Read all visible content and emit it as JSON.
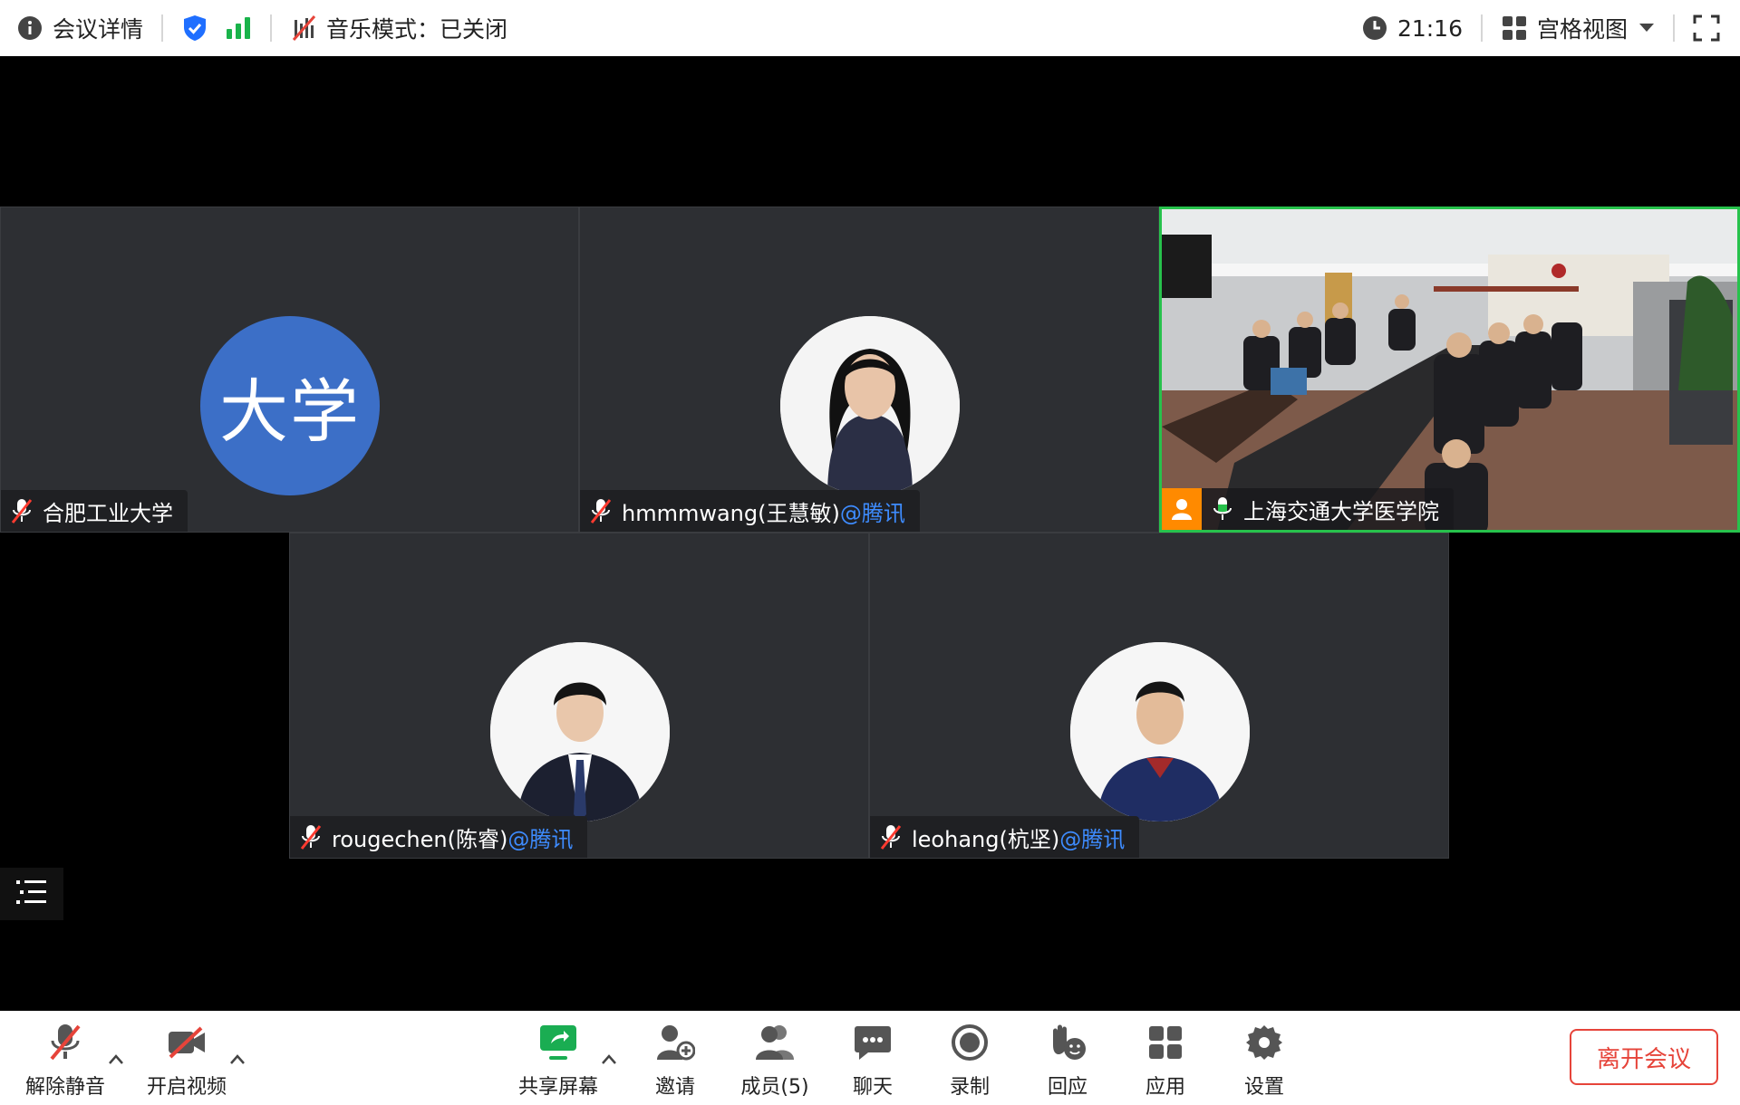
{
  "topbar": {
    "meeting_info": "会议详情",
    "music_mode": "音乐模式：已关闭",
    "time": "21:16",
    "view_mode": "宫格视图"
  },
  "tiles": [
    {
      "name": "合肥工业大学",
      "org": "",
      "avatar_text": "大学",
      "avatar_color": "#3c6fc7",
      "mic": "muted"
    },
    {
      "name": "hmmmwang(王慧敏)",
      "org": "@腾讯",
      "avatar": "photo",
      "mic": "muted"
    },
    {
      "name": "上海交通大学医学院",
      "org": "",
      "avatar": "video",
      "mic": "active",
      "speaking": true
    },
    {
      "name": "rougechen(陈睿)",
      "org": "@腾讯",
      "avatar": "photo",
      "mic": "muted"
    },
    {
      "name": "leohang(杭坚)",
      "org": "@腾讯",
      "avatar": "photo",
      "mic": "muted"
    }
  ],
  "toolbar": {
    "unmute": "解除静音",
    "start_video": "开启视频",
    "share_screen": "共享屏幕",
    "invite": "邀请",
    "members": "成员(5)",
    "chat": "聊天",
    "record": "录制",
    "reaction": "回应",
    "apps": "应用",
    "settings": "设置",
    "leave": "离开会议"
  },
  "colors": {
    "accent_green": "#27c24c",
    "org_blue": "#3e8cff",
    "leave_red": "#e6443a",
    "share_green": "#1aad52",
    "badge_orange": "#ff8a00"
  }
}
